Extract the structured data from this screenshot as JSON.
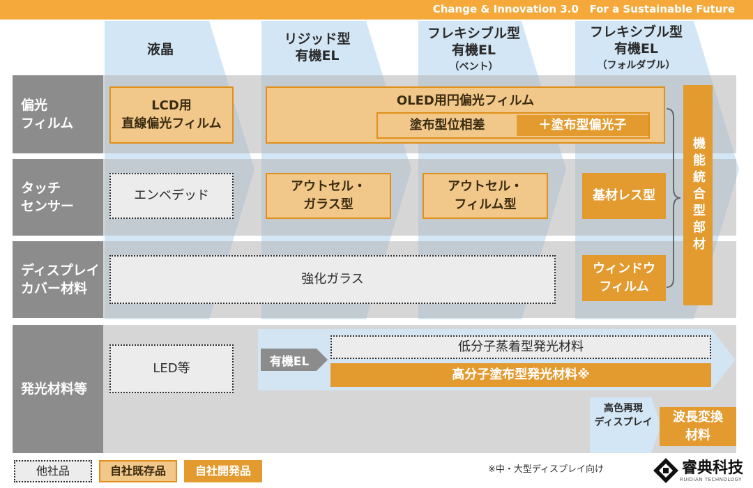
{
  "header": {
    "text": "Change & Innovation 3.0   For a Sustainable Future"
  },
  "columns": [
    {
      "line1": "液晶",
      "line2": "",
      "sub": ""
    },
    {
      "line1": "リジッド型",
      "line2": "有機EL",
      "sub": ""
    },
    {
      "line1": "フレキシブル型",
      "line2": "有機EL",
      "sub": "（ベント）"
    },
    {
      "line1": "フレキシブル型",
      "line2": "有機EL",
      "sub": "（フォルダブル）"
    }
  ],
  "rows": {
    "polarizer": {
      "line1": "偏光",
      "line2": "フィルム"
    },
    "touch": {
      "line1": "タッチ",
      "line2": "センサー"
    },
    "cover": {
      "line1": "ディスプレイ",
      "line2": "カバー材料"
    },
    "emitter": {
      "line1": "発光材料等",
      "line2": ""
    }
  },
  "boxes": {
    "lcd_polarizer": {
      "line1": "LCD用",
      "line2": "直線偏光フィルム"
    },
    "oled_polarizer": "OLED用円偏光フィルム",
    "coated_retarder": "塗布型位相差",
    "coated_polarizer": "＋塗布型偏光子",
    "embedded": "エンベデッド",
    "outcell_glass": {
      "line1": "アウトセル・",
      "line2": "ガラス型"
    },
    "outcell_film": {
      "line1": "アウトセル・",
      "line2": "フィルム型"
    },
    "substrateless": "基材レス型",
    "tempered_glass": "強化ガラス",
    "window_film": {
      "line1": "ウィンドウ",
      "line2": "フィルム"
    },
    "integrated": "機能統合型部材",
    "led": "LED等",
    "oled_label": "有機EL",
    "small_molecule": "低分子蒸着型発光材料",
    "polymer": "高分子塗布型発光材料※",
    "wide_gamut": {
      "line1": "高色再現",
      "line2": "ディスプレイ"
    },
    "wavelength": {
      "line1": "波長変換",
      "line2": "材料"
    }
  },
  "legend": {
    "other": "他社品",
    "existing": "自社既存品",
    "developing": "自社開発品"
  },
  "note": "※中・大型ディスプレイ向け",
  "logo": {
    "name": "睿典科技",
    "sub": "RUIDIAN TECHNOLOGY"
  },
  "colors": {
    "header": "#f5a93a",
    "existing_fill": "#f1c88a",
    "developing_fill": "#e39a2e",
    "chevron": "#d3e6f5",
    "row_label": "#8c8c8c"
  }
}
